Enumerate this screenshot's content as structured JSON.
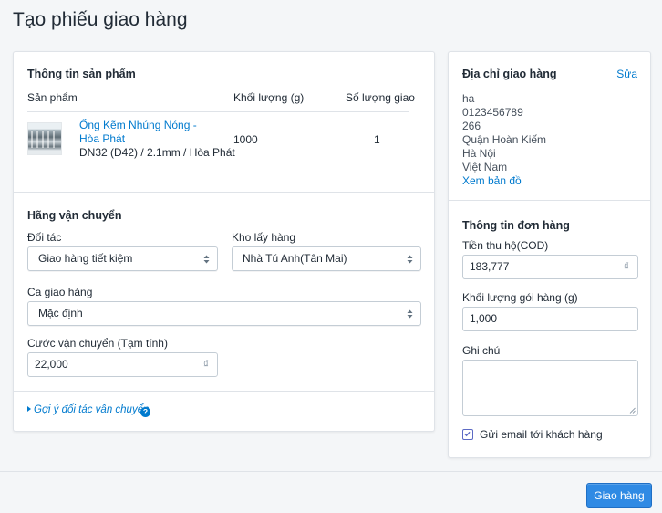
{
  "page": {
    "title": "Tạo phiếu giao hàng"
  },
  "product_section": {
    "title": "Thông tin sản phẩm",
    "columns": {
      "product": "Sản phẩm",
      "weight": "Khối lượng (g)",
      "quantity": "Số lượng giao"
    },
    "items": [
      {
        "name": "Ống Kẽm Nhúng Nóng - Hòa Phát",
        "variant": "DN32 (D42) / 2.1mm / Hòa Phát",
        "weight": "1000",
        "quantity": "1"
      }
    ]
  },
  "shipping_section": {
    "title": "Hãng vận chuyển",
    "partner": {
      "label": "Đối tác",
      "value": "Giao hàng tiết kiệm"
    },
    "warehouse": {
      "label": "Kho lấy hàng",
      "value": "Nhà Tú Anh(Tân Mai)"
    },
    "shift": {
      "label": "Ca giao hàng",
      "value": "Mặc định"
    },
    "fee": {
      "label": "Cước vận chuyển (Tạm tính)",
      "value": "22,000",
      "currency": "₫"
    },
    "suggest_link": "Gợi ý đối tác vận chuyển",
    "help_icon": "?"
  },
  "address_section": {
    "title": "Địa chỉ giao hàng",
    "edit_label": "Sửa",
    "lines": [
      "ha",
      "0123456789",
      "266",
      "Quận Hoàn Kiếm",
      "Hà Nội",
      "Việt Nam"
    ],
    "map_link": "Xem bản đồ"
  },
  "order_section": {
    "title": "Thông tin đơn hàng",
    "cod": {
      "label": "Tiền thu hộ(COD)",
      "value": "183,777",
      "currency": "₫"
    },
    "package_weight": {
      "label": "Khối lượng gói hàng (g)",
      "value": "1,000"
    },
    "note": {
      "label": "Ghi chú",
      "value": ""
    },
    "email_checkbox": {
      "label": "Gửi email tới khách hàng",
      "checked": true
    }
  },
  "footer": {
    "submit_label": "Giao hàng"
  },
  "colors": {
    "accent": "#007ace",
    "primary_button": "#2f8ae4",
    "checkbox": "#5c6ac4"
  },
  "icons": {
    "select_arrows": "up-down-arrows-icon",
    "checkbox": "checkmark-icon",
    "caret": "caret-right-icon"
  }
}
